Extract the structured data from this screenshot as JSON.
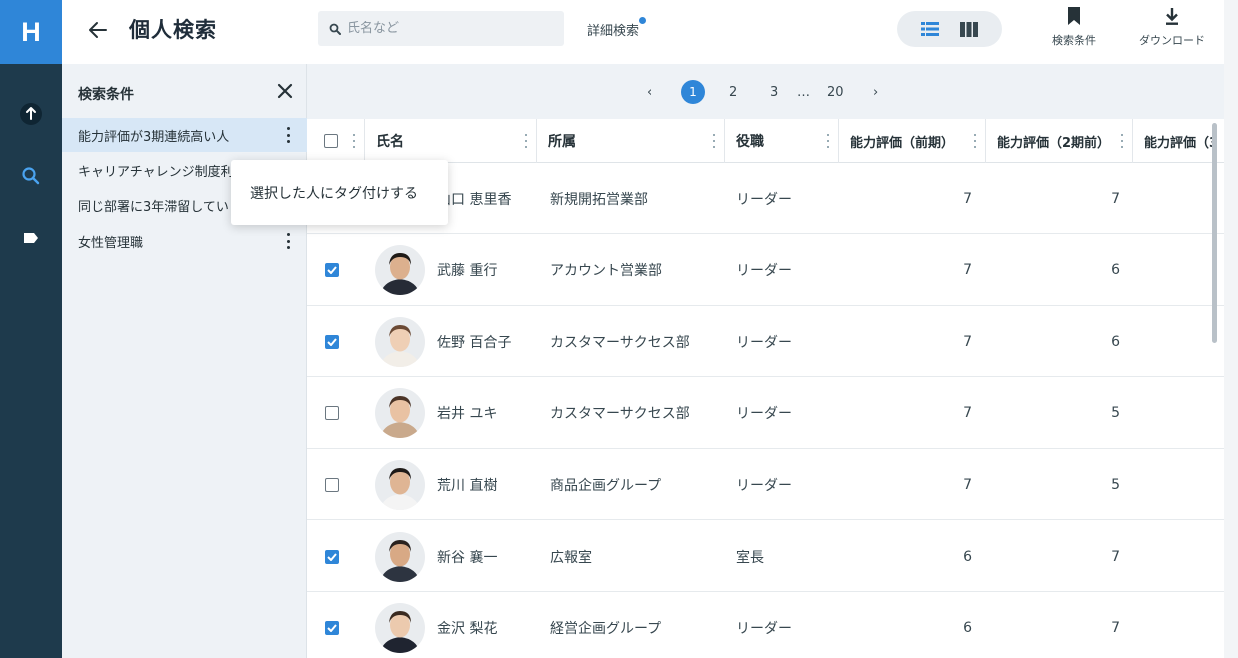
{
  "app": {
    "logo_letter": "H"
  },
  "header": {
    "title": "個人検索",
    "search_placeholder": "氏名など",
    "advanced_search": "詳細検索",
    "saved_conditions_label": "検索条件",
    "download_label": "ダウンロード"
  },
  "panel": {
    "title": "検索条件",
    "items": [
      {
        "label": "能力評価が3期連続高い人",
        "active": true
      },
      {
        "label": "キャリアチャレンジ制度利"
      },
      {
        "label": "同じ部署に3年滞留してい"
      },
      {
        "label": "女性管理職"
      }
    ]
  },
  "popup": {
    "label": "選択した人にタグ付けする"
  },
  "pagination": {
    "prev": "‹",
    "pages": [
      "1",
      "2",
      "3"
    ],
    "ellipsis": "…",
    "last": "20",
    "next": "›",
    "current": "1"
  },
  "table": {
    "columns": [
      "氏名",
      "所属",
      "役職",
      "能力評価（前期）",
      "能力評価（2期前）",
      "能力評価（3"
    ],
    "rows": [
      {
        "name": "山口 恵里香",
        "dept": "新規開拓営業部",
        "role": "リーダー",
        "prev": "7",
        "prev2": "7",
        "checked": false
      },
      {
        "name": "武藤 重行",
        "dept": "アカウント営業部",
        "role": "リーダー",
        "prev": "7",
        "prev2": "6",
        "checked": true
      },
      {
        "name": "佐野 百合子",
        "dept": "カスタマーサクセス部",
        "role": "リーダー",
        "prev": "7",
        "prev2": "6",
        "checked": true
      },
      {
        "name": "岩井 ユキ",
        "dept": "カスタマーサクセス部",
        "role": "リーダー",
        "prev": "7",
        "prev2": "5",
        "checked": false
      },
      {
        "name": "荒川 直樹",
        "dept": "商品企画グループ",
        "role": "リーダー",
        "prev": "7",
        "prev2": "5",
        "checked": false
      },
      {
        "name": "新谷 襄一",
        "dept": "広報室",
        "role": "室長",
        "prev": "6",
        "prev2": "7",
        "checked": true
      },
      {
        "name": "金沢 梨花",
        "dept": "経営企画グループ",
        "role": "リーダー",
        "prev": "6",
        "prev2": "7",
        "checked": true
      }
    ]
  },
  "colors": {
    "accent": "#2f86d8",
    "rail": "#1e3a4c",
    "panel": "#eef2f6"
  }
}
